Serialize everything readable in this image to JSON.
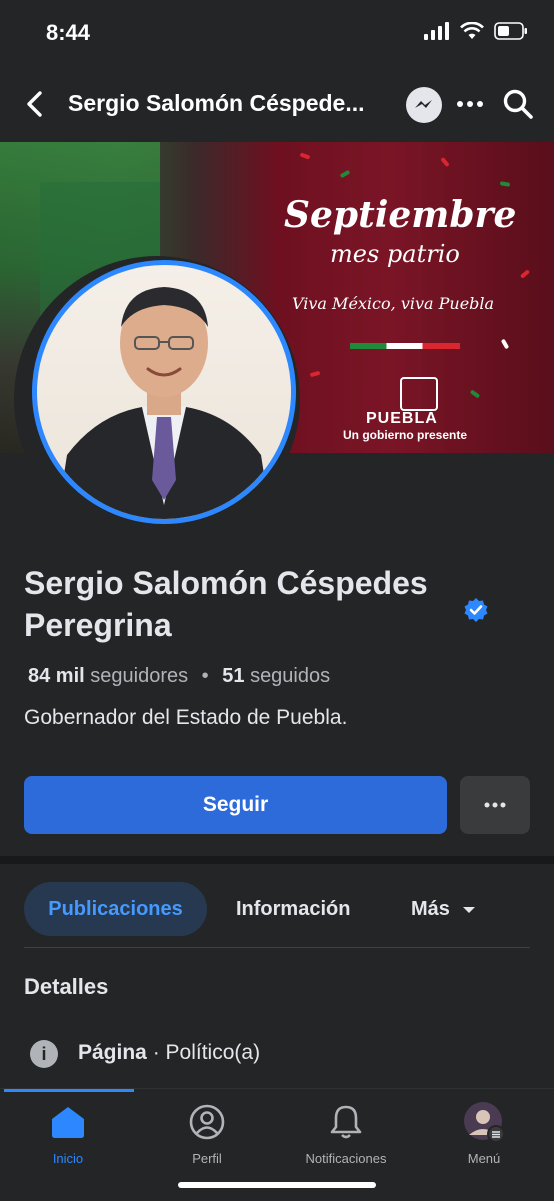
{
  "status_bar": {
    "time": "8:44"
  },
  "header": {
    "title": "Sergio Salomón Céspede..."
  },
  "cover": {
    "title": "Septiembre",
    "subtitle": "mes patrio",
    "slogan": "Viva México, viva Puebla",
    "brand": "PUEBLA",
    "tagline": "Un gobierno presente"
  },
  "profile": {
    "name": "Sergio Salomón Céspedes Peregrina",
    "followers_count": "84 mil",
    "followers_label": "seguidores",
    "separator": "•",
    "following_count": "51",
    "following_label": "seguidos",
    "bio": "Gobernador del Estado de Puebla."
  },
  "actions": {
    "follow_label": "Seguir",
    "more_label": "···"
  },
  "tabs": {
    "posts": "Publicaciones",
    "info": "Información",
    "more": "Más"
  },
  "details": {
    "title": "Detalles",
    "type_label": "Página",
    "type_value": "· Político(a)"
  },
  "bottom_nav": {
    "home": "Inicio",
    "profile": "Perfil",
    "notifications": "Notificaciones",
    "menu": "Menú"
  },
  "colors": {
    "accent": "#2d88ff",
    "button": "#2d6bdb",
    "background": "#242526"
  }
}
